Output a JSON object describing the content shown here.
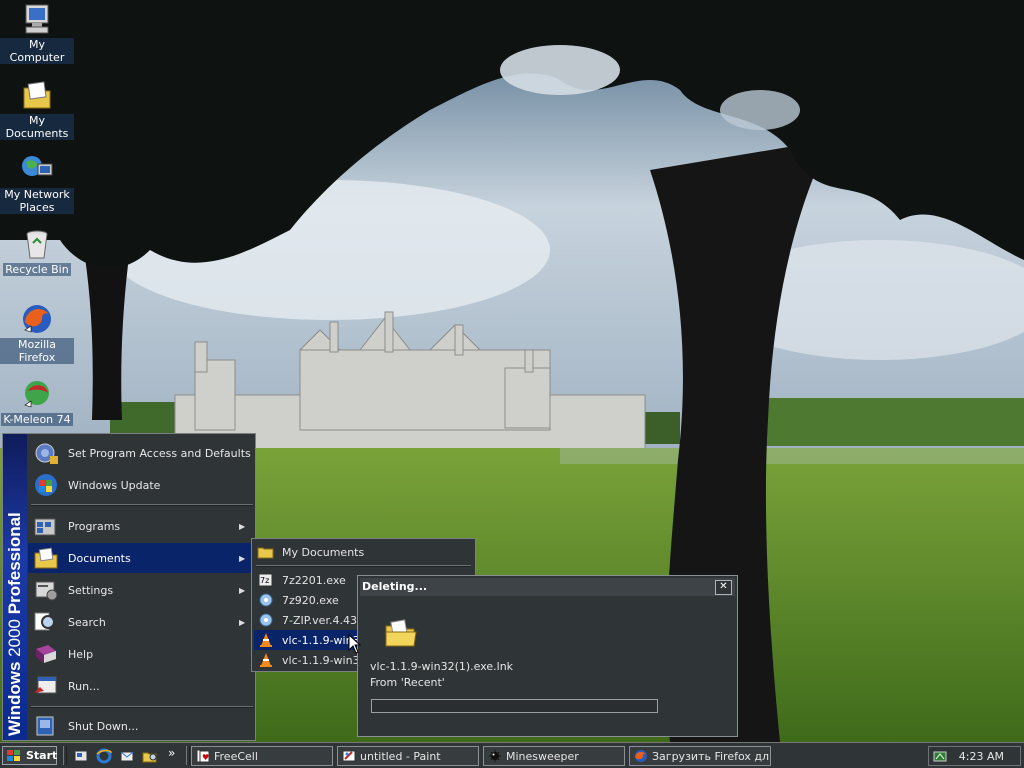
{
  "desktop": {
    "icons": [
      {
        "label": "My Computer",
        "icon": "my-computer-icon"
      },
      {
        "label": "My Documents",
        "icon": "my-documents-icon"
      },
      {
        "label": "My Network Places",
        "icon": "network-places-icon"
      },
      {
        "label": "Recycle Bin",
        "icon": "recycle-bin-icon"
      },
      {
        "label": "Mozilla Firefox",
        "icon": "firefox-icon"
      },
      {
        "label": "K-Meleon 74",
        "icon": "kmeleon-icon"
      }
    ]
  },
  "start_menu": {
    "banner_brand": "Windows",
    "banner_version": "2000",
    "banner_edition": "Professional",
    "items": [
      {
        "label": "Set Program Access and Defaults",
        "submenu": false
      },
      {
        "label": "Windows Update",
        "submenu": false
      },
      {
        "label": "Programs",
        "submenu": true
      },
      {
        "label": "Documents",
        "submenu": true,
        "active": true
      },
      {
        "label": "Settings",
        "submenu": true
      },
      {
        "label": "Search",
        "submenu": true
      },
      {
        "label": "Help",
        "submenu": false
      },
      {
        "label": "Run...",
        "submenu": false
      },
      {
        "label": "Shut Down...",
        "submenu": false
      }
    ],
    "arrow": "▶"
  },
  "documents_submenu": {
    "items": [
      {
        "label": "My Documents"
      },
      {
        "label": "7z2201.exe"
      },
      {
        "label": "7z920.exe"
      },
      {
        "label": "7-ZIP.ver.4.43 a"
      },
      {
        "label": "vlc-1.1.9-win32",
        "active": true
      },
      {
        "label": "vlc-1.1.9-win32."
      }
    ]
  },
  "delete_dialog": {
    "title": "Deleting...",
    "close_label": "✕",
    "file_name": "vlc-1.1.9-win32(1).exe.lnk",
    "from_text": "From 'Recent'",
    "progress": 0.0
  },
  "taskbar": {
    "start_label": "Start",
    "quick_launch_more": "»",
    "tasks": [
      {
        "label": "FreeCell"
      },
      {
        "label": "untitled - Paint"
      },
      {
        "label": "Minesweeper"
      },
      {
        "label": "Загрузить Firefox дл..."
      }
    ],
    "clock": "4:23 AM"
  },
  "colors": {
    "menu_bg": "#2f3437",
    "highlight": "#0a246a",
    "banner_blue": "#1c3aa7"
  }
}
